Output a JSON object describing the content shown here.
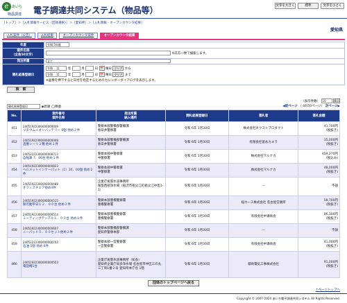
{
  "header": {
    "logo_sub": "あいち",
    "logo_main": "物品調達",
    "title": "電子調達共同システム（物品等）",
    "font_large": "文字を大きく",
    "font_std": "標準",
    "font_small": "文字を小さく"
  },
  "breadcrumb": "［トップ］＞［入札情報サービス（団体選択）］＞［愛知県］＞［入札情報 - オープンカウンタ結果］",
  "pref": "愛知県",
  "tabs": [
    "入札案件（公告）",
    "入札結果",
    "オープンカウンタ案件",
    "オープンカウンタ結果"
  ],
  "form": {
    "year_label": "年度",
    "year_value": "令和 5年度",
    "case_label": "案件名称\n（全角50文字）",
    "case_note": "※前方一致で検索します。",
    "section_label": "発注所属",
    "section_value": "全て",
    "date_label": "開札結果登録日",
    "era": "令和",
    "month": "月",
    "day": "日",
    "cal": "📅",
    "yobi": "曜日",
    "clear": "クリア",
    "from": "から",
    "to": "まで",
    "date_note": "※画像を押下すると日付を指定するためのカレンダーダイアログを表示します。",
    "search": "検　索"
  },
  "sort": {
    "value": "開札結果登録日",
    "asc": "昇順",
    "desc": "降順"
  },
  "count": "（表示件数）",
  "count_val": "10",
  "pager_prev": "前ページ",
  "pager_info": "（ 46/50ページ）",
  "pager_next": "次ページ",
  "columns": [
    "No.",
    "案件番号\n案件名称",
    "発注所属\n納入場所",
    "開札結果登録日",
    "落札者",
    "落札金額"
  ],
  "rows": [
    {
      "no": "451",
      "id": "24051922300000000009",
      "name": "リチウムイオンバッテリー 6個 他め２件",
      "dept": "警察本部警備部警備課",
      "place": "春日井警察署",
      "date": "令和 6年 1月30日",
      "winner": "株式会社ネクストプロダクト",
      "amount": "41,700円",
      "tax": "(税抜き)"
    },
    {
      "no": "452",
      "id": "24051922300000000008",
      "name": "過塞シーリ２種 他め１件",
      "dept": "警察本部警備部警備課",
      "place": "春日井警察署",
      "date": "令和 6年 1月30日",
      "winner": "有限会社富永カメラ",
      "amount": "35,000円",
      "tax": "(税抜き)"
    },
    {
      "no": "453",
      "id": "24052222300000008713",
      "name": "自転車 7．00台 他め１件",
      "dept": "警察本部中警察署",
      "place": "中警察署",
      "date": "令和 6年 1月30日",
      "winner": "株式会社マルナカ",
      "amount": "459,270円",
      "tax": "(税込み)"
    },
    {
      "no": "454",
      "id": "24051922300000000823",
      "name": "ヘルメットインナーパット（1）30．00個 他め２件",
      "dept": "警察本部中警察署",
      "place": "中警察署",
      "date": "令和 6年 1月30日",
      "winner": "株式会社マルナカ",
      "amount": "48,000円",
      "tax": "(税抜き)"
    },
    {
      "no": "455",
      "id": "24051922300000000488",
      "name": "オフィスチェア他め4件",
      "dept": "企業庁尾張水道事務所",
      "place": "尾張西部浄水場（稲沢市祖父江町祖父江中島1-1）",
      "date": "令和 6年 1月30日",
      "winner": "---",
      "amount": "不調",
      "tax": ""
    },
    {
      "no": "456",
      "id": "24051922300000000515",
      "name": "耐可動平日１２．００台 他め２件",
      "dept": "警察本部豊橋警察署",
      "place": "豊橋警察署",
      "date": "令和 6年 1月30日",
      "winner": "桜ホース株式会社 名古屋営業所",
      "amount": "58,700円",
      "tax": "(税抜き)"
    },
    {
      "no": "457",
      "id": "24051922300000000514",
      "name": "ミーティングテーブル１．００台 他め１件",
      "dept": "警察本部豊橋警察署",
      "place": "豊橋警察署",
      "date": "令和 6年 1月30日",
      "winner": "有限会社中瀬商会",
      "amount": "86,100円",
      "tax": "(税抜き)"
    },
    {
      "no": "458",
      "id": "24051922300000000607",
      "name": "ニーパッド５．００セット他め２件",
      "dept": "警察本部警備部警備課",
      "place": "愛知県警察本部",
      "date": "令和 6年 1月30日",
      "winner": "---",
      "amount": "不調",
      "tax": ""
    },
    {
      "no": "459",
      "id": "24052222300000000703",
      "name": "石油 5個 他め 6件",
      "dept": "警察本部一宮警察署",
      "place": "一宮警察署",
      "date": "令和 6年 1月30日",
      "winner": "有限会社中瀬商会",
      "amount": "41,000円",
      "tax": "(税抜き)"
    },
    {
      "no": "460",
      "id": "24051922300000000553",
      "name": "電話機1台",
      "dept": "企業庁尾張水道事務所（知多）",
      "place": "愛知県企業庁知多浄水場 名古屋市中区三の丸三丁目1番２号 愛知県本庁舎 1階",
      "date": "令和 6年 1月30日",
      "winner": "都商電気工事株式会社",
      "amount": "91,000円",
      "tax": "(税抜き)"
    }
  ],
  "back": "団体のトップページへ戻る",
  "pagetop": "↑ページトップへ",
  "footer": "Copyright © 2007-2024 あいち電子調達共同システム All Rights Reserved."
}
